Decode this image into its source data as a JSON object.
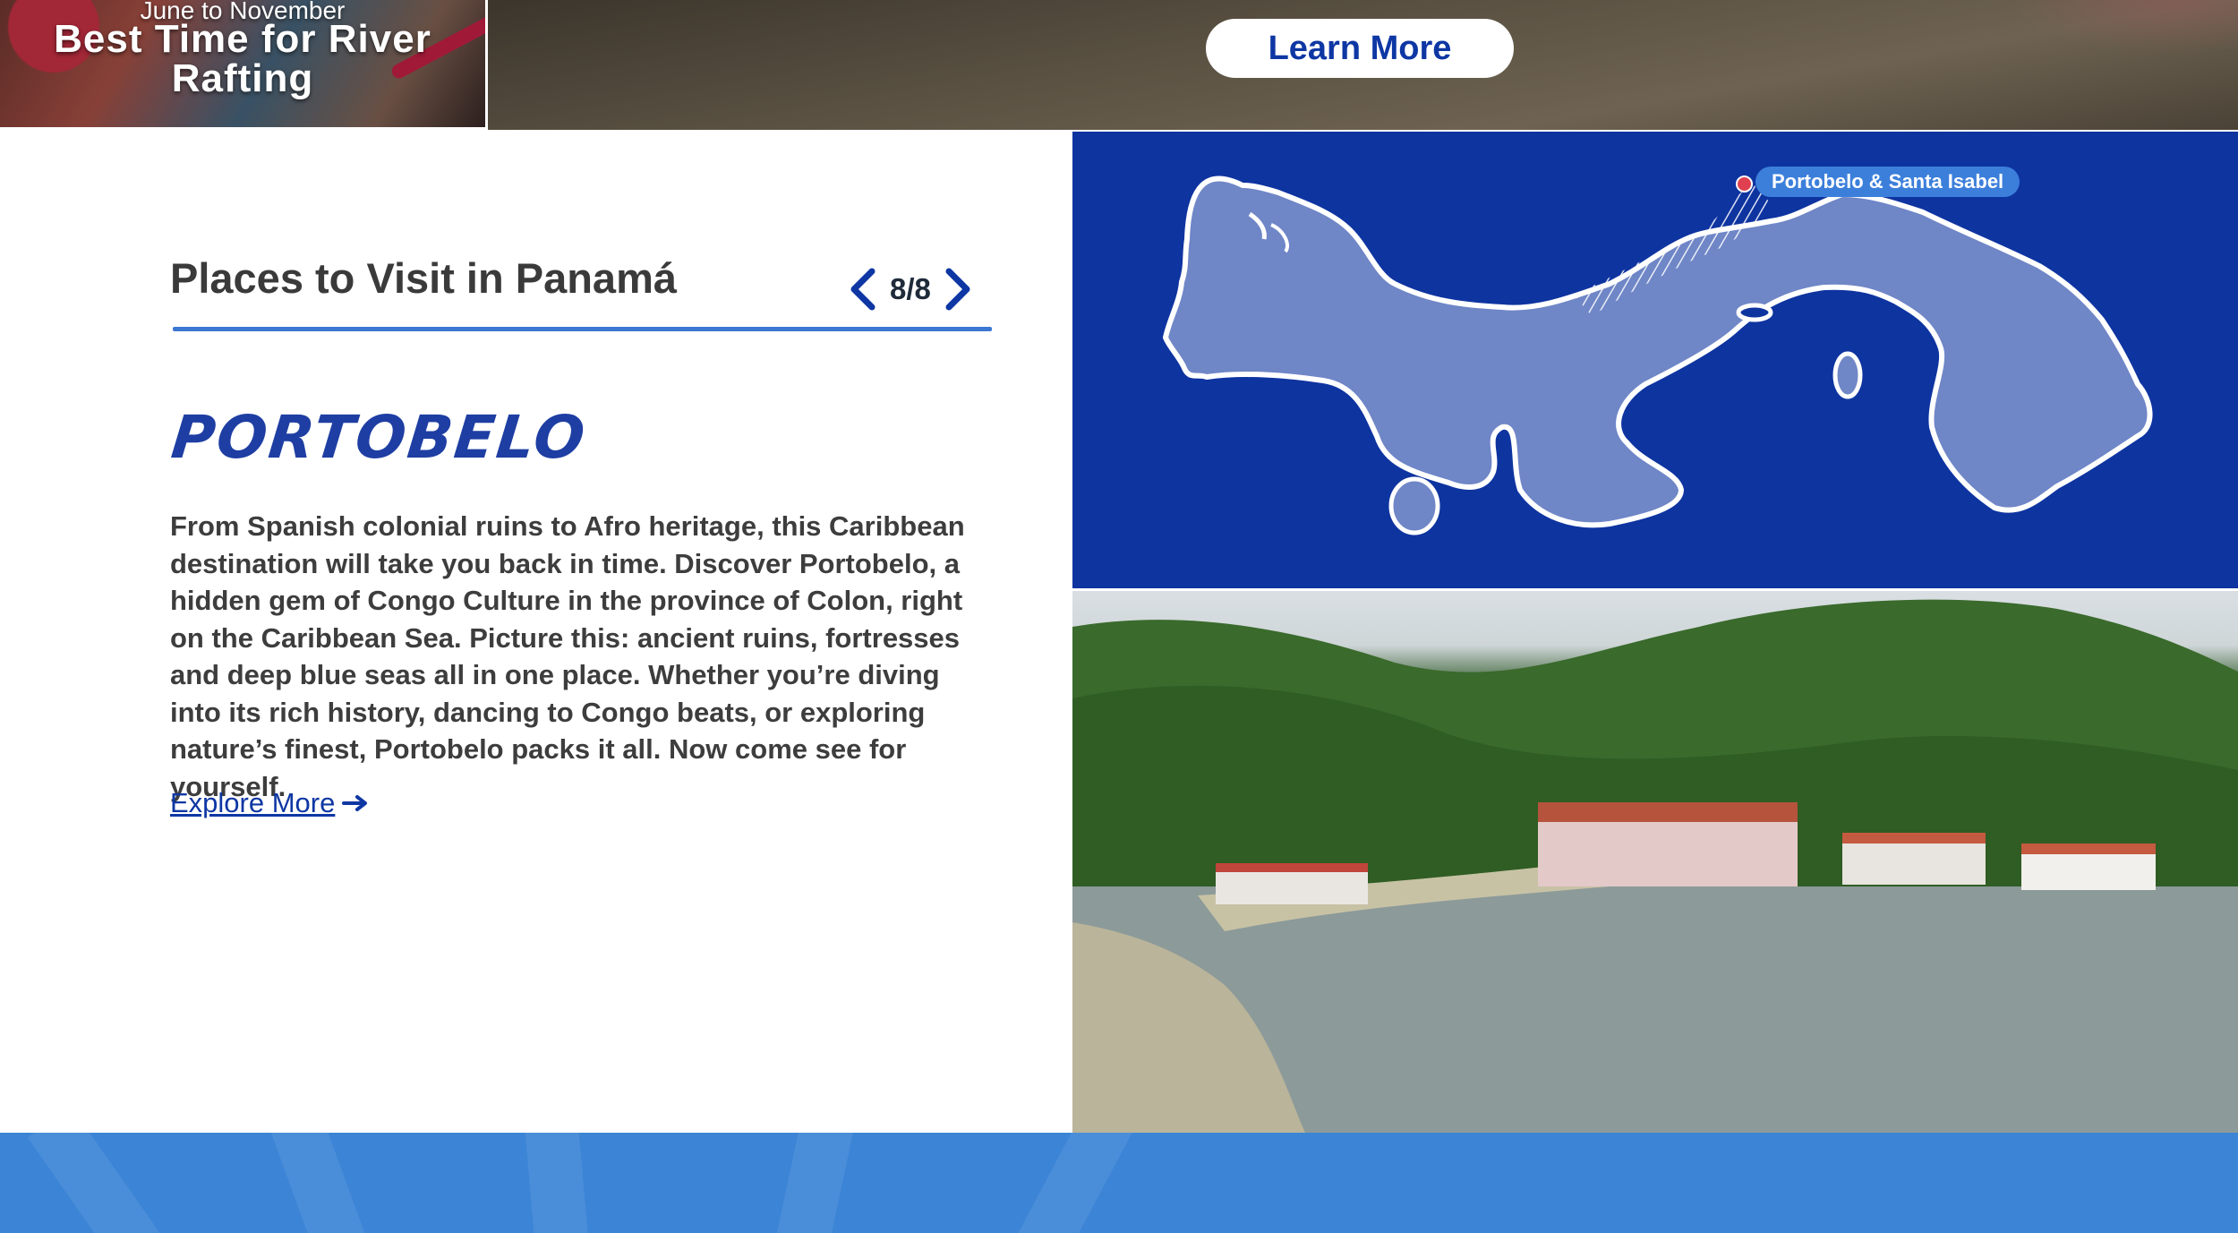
{
  "banner": {
    "card_subtitle": "June to November",
    "card_title": "Best Time for River Rafting",
    "cta_label": "Learn More"
  },
  "places": {
    "section_title": "Places to Visit in Panamá",
    "pager_count": "8/8",
    "place_name": "PORTOBELO",
    "description": "From Spanish colonial ruins to Afro heritage, this Caribbean destination will take you back in time. Discover Portobelo, a hidden gem of Congo Culture in the province of Colon, right on the Caribbean Sea. Picture this: ancient ruins, fortresses and deep blue seas all in one place. Whether you’re diving into its rich history, dancing to Congo beats, or exploring nature’s finest, Portobelo packs it all. Now come see for yourself.",
    "explore_label": "Explore More"
  },
  "map": {
    "label": "Portobelo & Santa Isabel"
  },
  "icons": {
    "prev": "chevron-left-icon",
    "next": "chevron-right-icon",
    "explore": "arrow-right-icon",
    "pin": "map-pin-icon"
  },
  "colors": {
    "brand_blue": "#0e37a4",
    "accent_blue": "#3c78d2",
    "map_bg": "#0e34a0",
    "map_land": "#6f86c7",
    "footer_blue": "#3b84d6"
  }
}
